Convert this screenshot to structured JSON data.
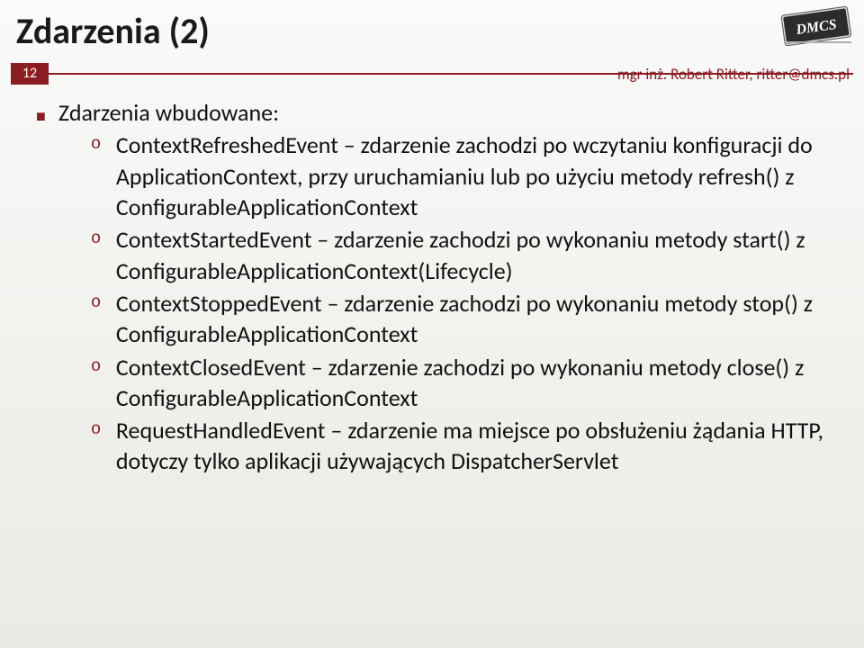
{
  "title": "Zdarzenia (2)",
  "page": "12",
  "attribution": "mgr inż. Robert Ritter, ritter@dmcs.pl",
  "logo_text": "DMCS",
  "intro": "Zdarzenia wbudowane:",
  "items": [
    {
      "term": "ContextRefreshedEvent",
      "desc": " – zdarzenie zachodzi po wczytaniu konfiguracji do ApplicationContext, przy uruchamianiu lub po użyciu metody refresh() z ConfigurableApplicationContext"
    },
    {
      "term": "ContextStartedEvent",
      "desc": " – zdarzenie zachodzi po wykonaniu metody start() z ConfigurableApplicationContext(Lifecycle)"
    },
    {
      "term": "ContextStoppedEvent",
      "desc": " – zdarzenie zachodzi po wykonaniu metody stop() z ConfigurableApplicationContext"
    },
    {
      "term": "ContextClosedEvent",
      "desc": " – zdarzenie zachodzi po wykonaniu metody close() z ConfigurableApplicationContext"
    },
    {
      "term": "RequestHandledEvent",
      "desc": " – zdarzenie ma miejsce po obsłużeniu żądania HTTP, dotyczy tylko aplikacji używających DispatcherServlet"
    }
  ]
}
